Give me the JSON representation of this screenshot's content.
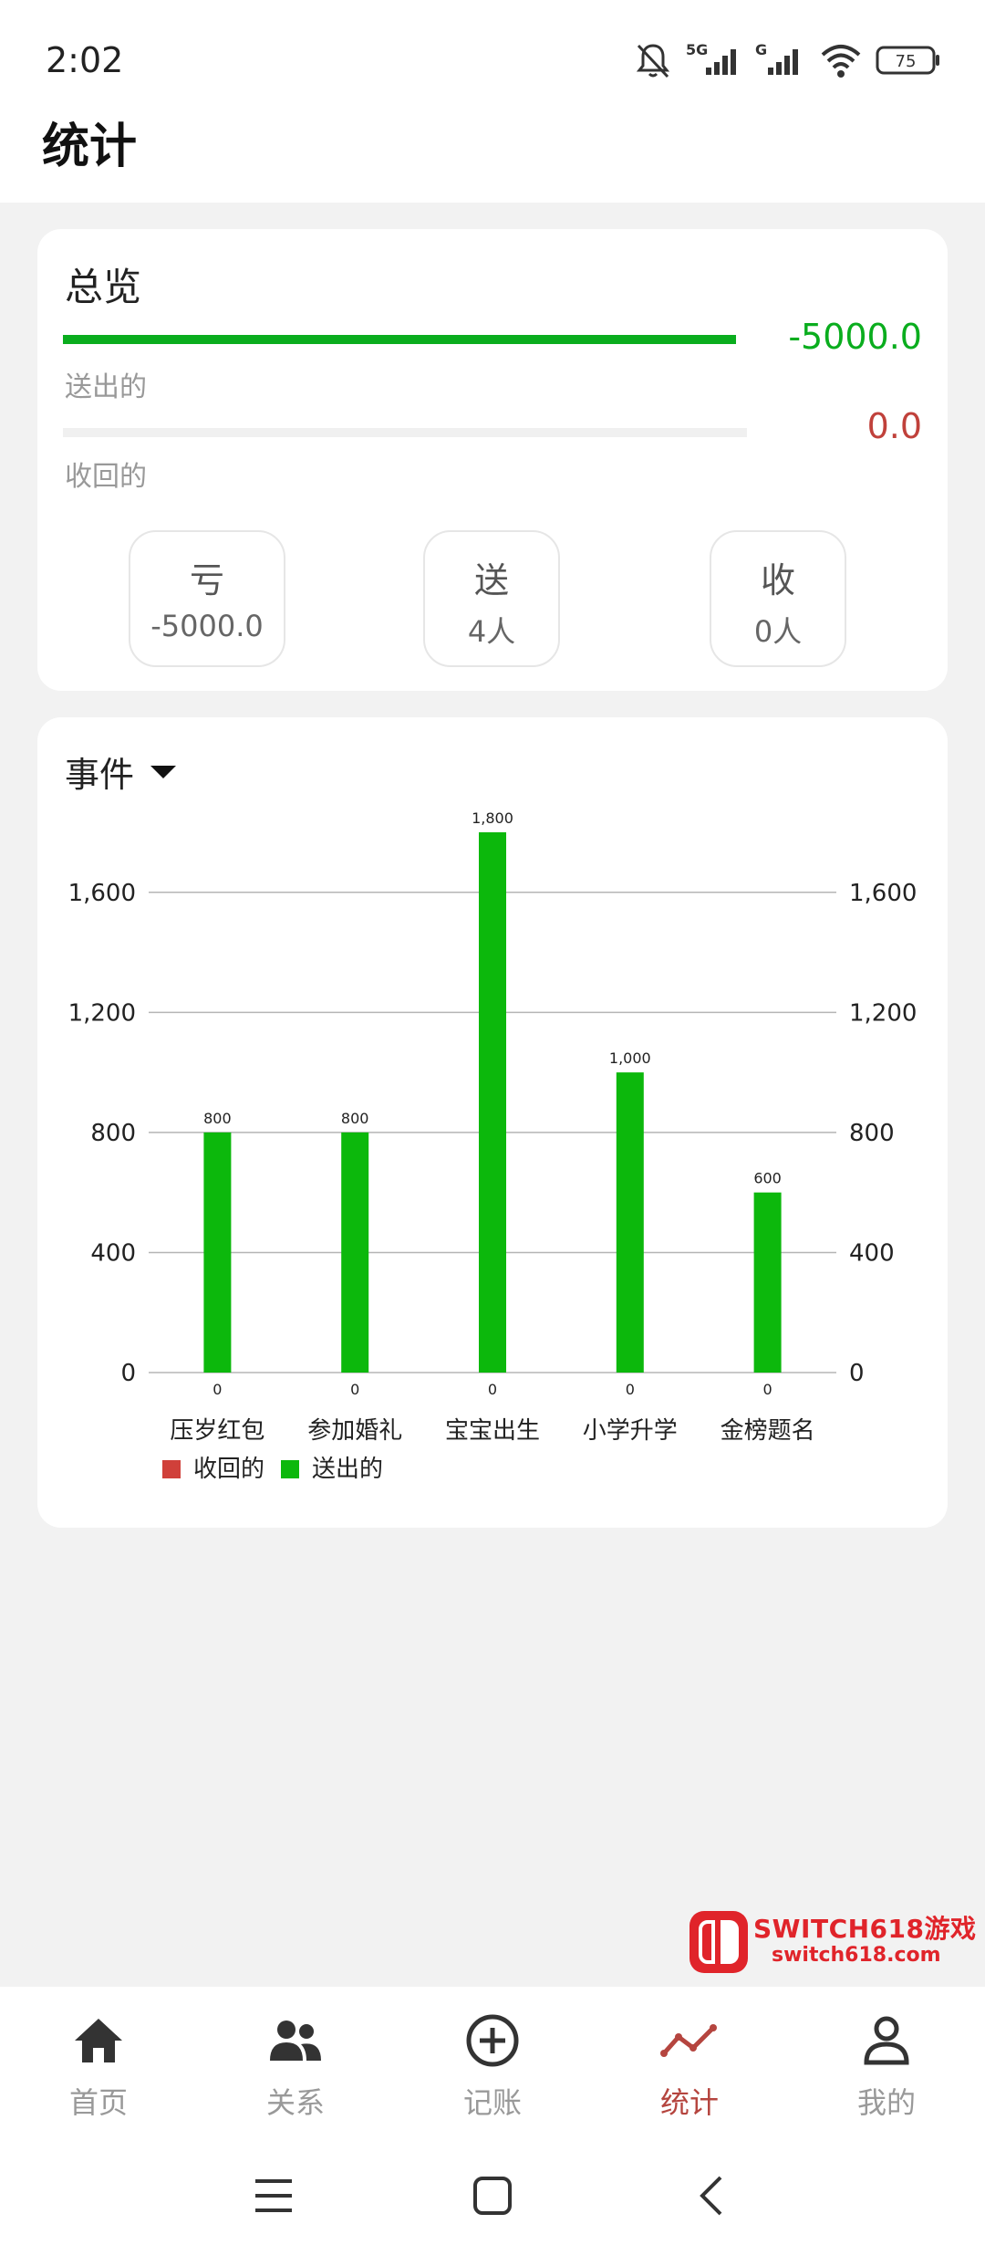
{
  "status_bar": {
    "time": "2:02",
    "battery": "75",
    "net1": "5G",
    "net2": "G"
  },
  "header": {
    "title": "统计"
  },
  "overview": {
    "title": "总览",
    "sent": {
      "label": "送出的",
      "value": "-5000.0",
      "fill_fraction": 1.0,
      "color": "#0aad1e"
    },
    "received": {
      "label": "收回的",
      "value": "0.0",
      "fill_fraction": 0.0,
      "color": "#c0413b"
    },
    "stats": [
      {
        "title": "亏",
        "value": "-5000.0"
      },
      {
        "title": "送",
        "value": "4人"
      },
      {
        "title": "收",
        "value": "0人"
      }
    ]
  },
  "event": {
    "selector_label": "事件"
  },
  "chart_data": {
    "type": "bar",
    "categories": [
      "压岁红包",
      "参加婚礼",
      "宝宝出生",
      "小学升学",
      "金榜题名"
    ],
    "series": [
      {
        "name": "收回的",
        "values": [
          0,
          0,
          0,
          0,
          0
        ],
        "color": "#d0403a"
      },
      {
        "name": "送出的",
        "values": [
          800,
          800,
          1800,
          1000,
          600
        ],
        "color": "#0cb80c"
      }
    ],
    "data_labels_sent": [
      "800",
      "800",
      "1,800",
      "1,000",
      "600"
    ],
    "data_labels_received": [
      "0",
      "0",
      "0",
      "0",
      "0"
    ],
    "yticks": [
      "0",
      "400",
      "800",
      "1,200",
      "1,600"
    ],
    "ytick_values": [
      0,
      400,
      800,
      1200,
      1600
    ],
    "ylim": [
      0,
      1800
    ],
    "grid": true,
    "legend_position": "bottom-left",
    "dual_y_axis": true
  },
  "nav": {
    "items": [
      {
        "label": "首页",
        "icon": "home-icon",
        "active": false
      },
      {
        "label": "关系",
        "icon": "people-icon",
        "active": false
      },
      {
        "label": "记账",
        "icon": "add-circle-icon",
        "active": false
      },
      {
        "label": "统计",
        "icon": "chart-line-icon",
        "active": true
      },
      {
        "label": "我的",
        "icon": "person-icon",
        "active": false
      }
    ],
    "active_color": "#b5453f",
    "inactive_color": "#999999"
  },
  "watermark": {
    "line1": "SWITCH618游戏",
    "line2": "switch618.com"
  }
}
